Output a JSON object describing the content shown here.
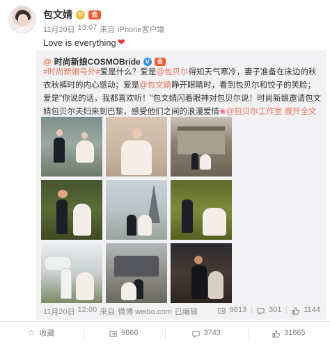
{
  "author": {
    "name": "包文婧",
    "verified_badge": "V",
    "vip_badge": "会",
    "date": "11月20日",
    "time": "13:07",
    "source_prefix": "来自",
    "source": "iPhone客户端"
  },
  "post": {
    "text": "Love is everything",
    "heart_icon": "❤"
  },
  "repost": {
    "user_prefix": "@",
    "user": "时尚新娘COSMOBride",
    "verified_badge": "V",
    "vip_badge": "会",
    "body": {
      "hashtag": "#时尚新娘号外#",
      "t1": "爱是什么？爱是",
      "mention1": "@包贝尔",
      "t2": "得知天气寒冷，妻子准备在床边的秋衣秋裤时的内心感动；爱是",
      "mention2": "@包文婧",
      "t3": "睁开眼睛时，看到包贝尔和饺子的笑脸；爱是\"你说的话，我都喜欢听！\"包文婧闪着眼神对包贝尔说！时尚新娘邀请包文婧包贝尔夫妇来到巴黎，感受他们之间的浪漫爱情",
      "flower": "❀",
      "mention3": "@包贝尔工作室",
      "expand": "展开全文",
      "expand_chevron": "⌄"
    },
    "photos": [
      "photo-1",
      "photo-2",
      "photo-3",
      "photo-4",
      "photo-5",
      "photo-6",
      "photo-7",
      "photo-8",
      "photo-9"
    ],
    "footer": {
      "date": "11月20日",
      "time": "12:00",
      "source_prefix": "来自",
      "source": "微博 weibo.com",
      "edited": "已编辑",
      "forward_count": "9813",
      "comment_count": "301",
      "like_count": "1144"
    }
  },
  "actions": {
    "favorite": "收藏",
    "forward": "9666",
    "comment": "3743",
    "like": "31665"
  },
  "colors": {
    "link": "#eb7350",
    "heart": "#e8312f",
    "repost_bg": "#f2f2f5"
  }
}
